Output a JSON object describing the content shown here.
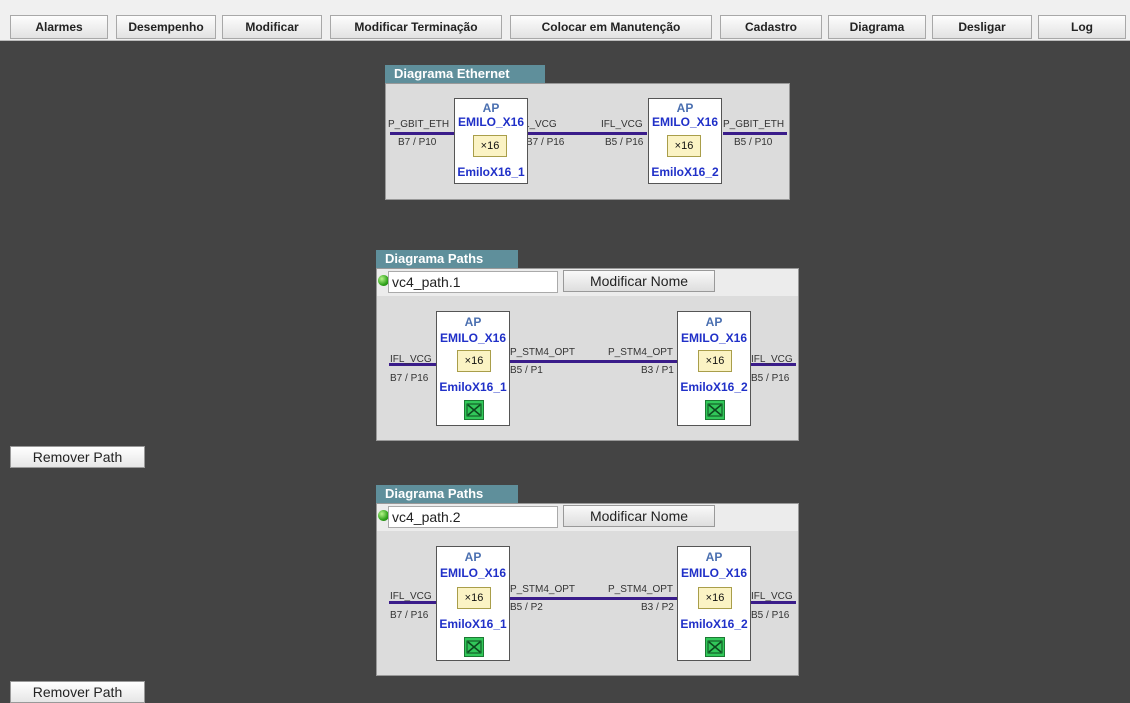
{
  "toolbar": {
    "buttons": [
      "Alarmes",
      "Desempenho",
      "Modificar",
      "Modificar Terminação",
      "Colocar em Manutenção",
      "Cadastro",
      "Diagrama",
      "Desligar",
      "Log"
    ]
  },
  "ethernet": {
    "title": "Diagrama Ethernet",
    "left_port": "P_GBIT_ETH",
    "left_slot": "B7 / P10",
    "mid_left_port": "IFL_VCG",
    "mid_left_slot": "B7 / P16",
    "mid_right_port": "IFL_VCG",
    "mid_right_slot": "B5 / P16",
    "right_port": "P_GBIT_ETH",
    "right_slot": "B5 / P10",
    "node1": {
      "ap": "AP",
      "type": "EMILO_X16",
      "x": "X16",
      "name": "EmiloX16_1"
    },
    "node2": {
      "ap": "AP",
      "type": "EMILO_X16",
      "x": "X16",
      "name": "EmiloX16_2"
    }
  },
  "paths": [
    {
      "title": "Diagrama Paths",
      "name": "vc4_path.1",
      "modify_label": "Modificar Nome",
      "left_port": "IFL_VCG",
      "left_slot": "B7 / P16",
      "mid_left_port": "P_STM4_OPT",
      "mid_left_slot": "B5 / P1",
      "mid_right_port": "P_STM4_OPT",
      "mid_right_slot": "B3 / P1",
      "right_port": "IFL_VCG",
      "right_slot": "B5 / P16",
      "node1": {
        "ap": "AP",
        "type": "EMILO_X16",
        "x": "X16",
        "name": "EmiloX16_1"
      },
      "node2": {
        "ap": "AP",
        "type": "EMILO_X16",
        "x": "X16",
        "name": "EmiloX16_2"
      },
      "remove_label": "Remover Path"
    },
    {
      "title": "Diagrama Paths",
      "name": "vc4_path.2",
      "modify_label": "Modificar Nome",
      "left_port": "IFL_VCG",
      "left_slot": "B7 / P16",
      "mid_left_port": "P_STM4_OPT",
      "mid_left_slot": "B5 / P2",
      "mid_right_port": "P_STM4_OPT",
      "mid_right_slot": "B3 / P2",
      "right_port": "IFL_VCG",
      "right_slot": "B5 / P16",
      "node1": {
        "ap": "AP",
        "type": "EMILO_X16",
        "x": "X16",
        "name": "EmiloX16_1"
      },
      "node2": {
        "ap": "AP",
        "type": "EMILO_X16",
        "x": "X16",
        "name": "EmiloX16_2"
      },
      "remove_label": "Remover Path"
    }
  ],
  "colors": {
    "background": "#444444",
    "panel": "#dcdcdc",
    "panel_tab": "#5f8f9b",
    "link_line": "#3a1c8a",
    "status_led": "#2ea11a"
  }
}
